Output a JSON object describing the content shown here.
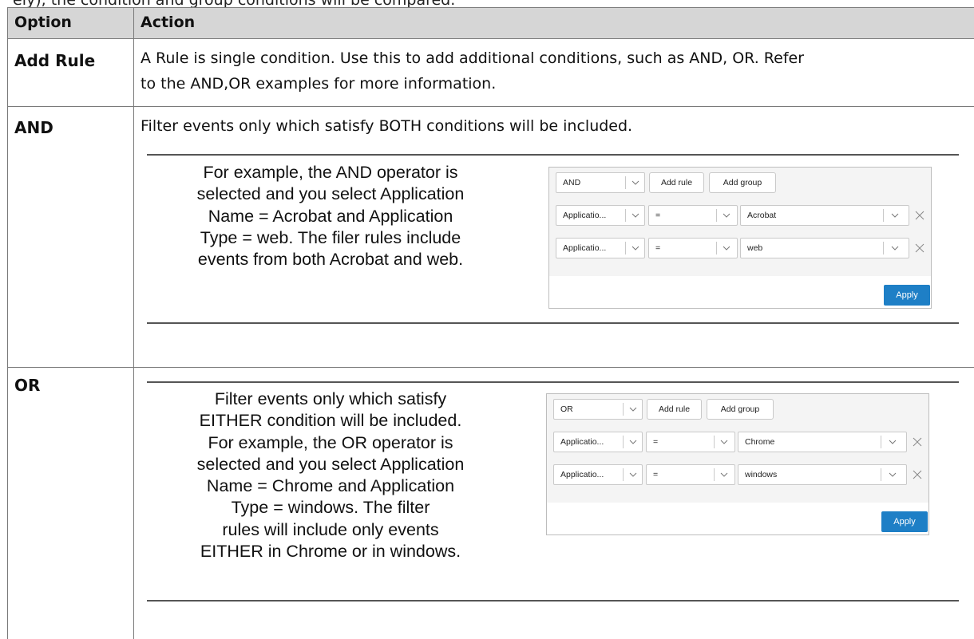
{
  "cut_top_text": "ely), the condition and group conditions will be compared.",
  "table": {
    "headers": {
      "option": "Option",
      "action": "Action"
    },
    "rows": {
      "add_rule": {
        "option": "Add Rule",
        "line1": "A Rule is single condition. Use this to add additional conditions, such as AND, OR. Refer",
        "line2": "to the AND,OR examples for more information."
      },
      "and": {
        "option": "AND",
        "intro": "Filter events only which satisfy BOTH conditions will be included.",
        "example_lines": [
          "For example, the AND operator is",
          "selected and you select Application",
          "Name = Acrobat and Application",
          "Type = web. The filer rules include",
          "events from both Acrobat and web."
        ],
        "widget": {
          "operator": "AND",
          "add_rule": "Add rule",
          "add_group": "Add group",
          "rules": [
            {
              "field": "Applicatio...",
              "op": "=",
              "value": "Acrobat"
            },
            {
              "field": "Applicatio...",
              "op": "=",
              "value": "web"
            }
          ],
          "apply": "Apply"
        }
      },
      "or": {
        "option": "OR",
        "example_lines": [
          "Filter events only which satisfy",
          "EITHER condition will be included.",
          "For example, the OR operator is",
          "selected and you select Application",
          "Name = Chrome and Application",
          "Type = windows. The filter",
          "rules will include only events",
          "EITHER in Chrome or in windows."
        ],
        "widget": {
          "operator": "OR",
          "add_rule": "Add rule",
          "add_group": "Add group",
          "rules": [
            {
              "field": "Applicatio...",
              "op": "=",
              "value": "Chrome"
            },
            {
              "field": "Applicatio...",
              "op": "=",
              "value": "windows"
            }
          ],
          "apply": "Apply"
        }
      }
    }
  },
  "icons": {
    "chevron": "chevron-down-icon",
    "remove": "close-icon"
  },
  "colors": {
    "header_bg": "#d6d6d6",
    "apply_button": "#1e7fc6",
    "border": "#7a7a7a"
  }
}
